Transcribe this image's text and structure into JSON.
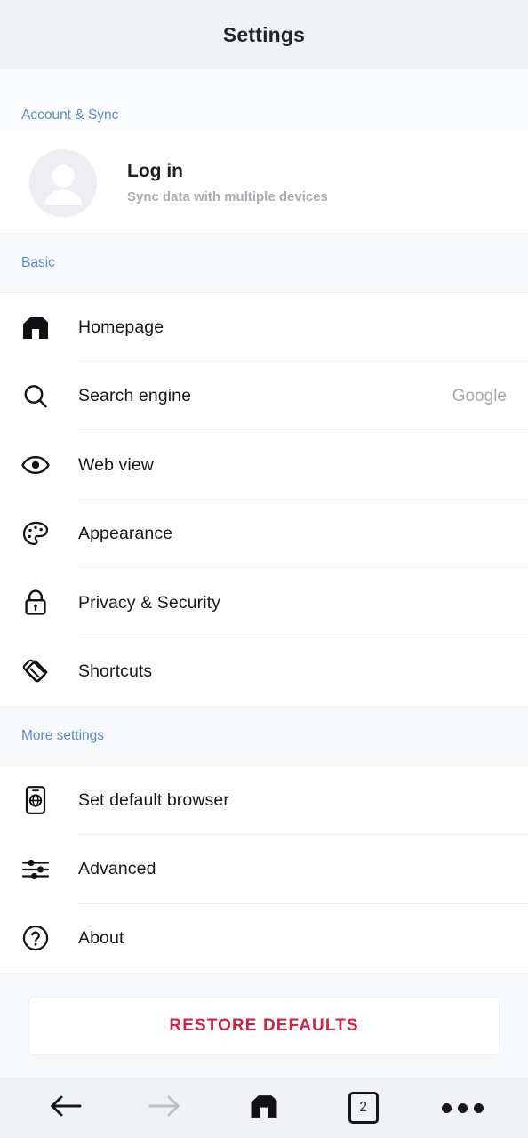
{
  "appbar": {
    "title": "Settings"
  },
  "sections": {
    "account": {
      "header": "Account & Sync",
      "avatar_icon": "user-avatar-icon",
      "title": "Log in",
      "subtitle": "Sync data with multiple devices"
    },
    "basic": {
      "header": "Basic",
      "items": [
        {
          "label": "Homepage",
          "value": "",
          "icon": "maxthon-logo-icon"
        },
        {
          "label": "Search engine",
          "value": "Google",
          "icon": "search-icon"
        },
        {
          "label": "Web view",
          "value": "",
          "icon": "eye-icon"
        },
        {
          "label": "Appearance",
          "value": "",
          "icon": "palette-icon"
        },
        {
          "label": "Privacy & Security",
          "value": "",
          "icon": "lock-icon"
        },
        {
          "label": "Shortcuts",
          "value": "",
          "icon": "shortcuts-icon"
        }
      ]
    },
    "more": {
      "header": "More settings",
      "items": [
        {
          "label": "Set default browser",
          "value": "",
          "icon": "phone-globe-icon"
        },
        {
          "label": "Advanced",
          "value": "",
          "icon": "sliders-icon"
        },
        {
          "label": "About",
          "value": "",
          "icon": "question-circle-icon"
        }
      ]
    }
  },
  "restore": {
    "label": "RESTORE DEFAULTS",
    "color": "#cf2442"
  },
  "bottombar": {
    "back_icon": "arrow-left-icon",
    "forward_icon": "arrow-right-icon",
    "home_icon": "maxthon-logo-icon",
    "tab_count": "2",
    "menu_icon": "overflow-menu-icon"
  },
  "colors": {
    "section_header": "#5d8bc9",
    "bar_background": "#f1f2f6",
    "accent_red": "#cf2442",
    "value_text": "#a4a8af"
  }
}
